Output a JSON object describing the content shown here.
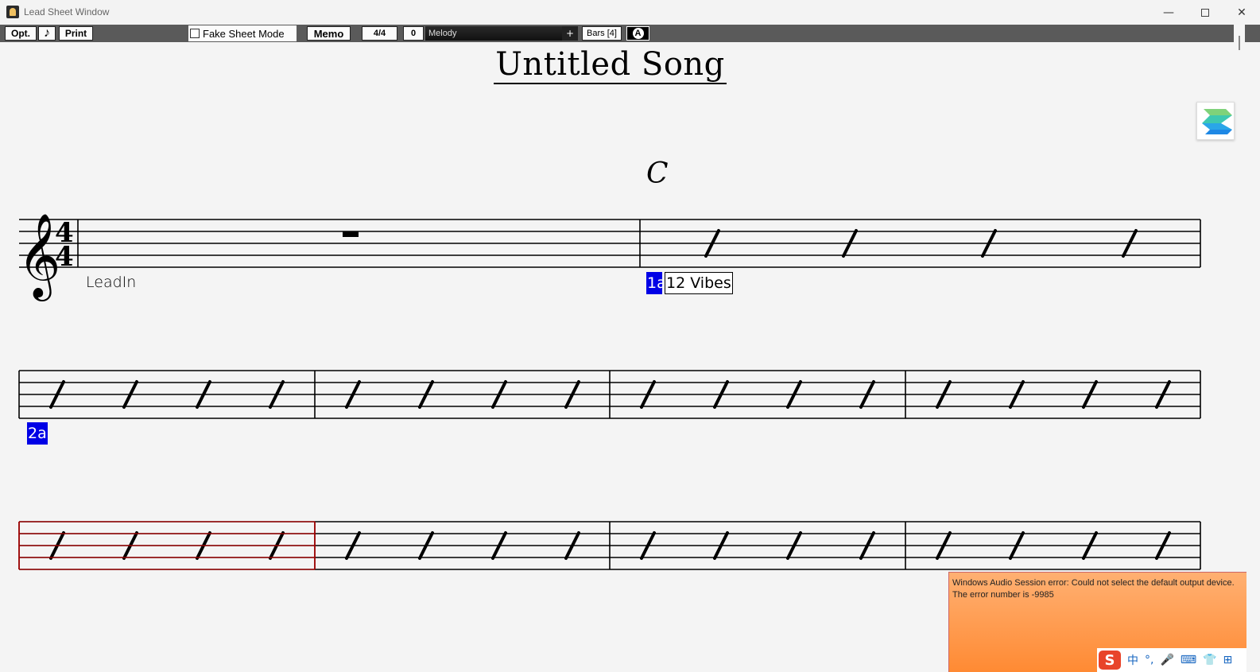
{
  "window": {
    "title": "Lead Sheet Window",
    "minimize_glyph": "—",
    "close_glyph": "✕"
  },
  "toolbar": {
    "opt_label": "Opt.",
    "note_glyph": "♪",
    "print_label": "Print",
    "fake_sheet_label": "Fake Sheet Mode",
    "memo_label": "Memo",
    "time_sig_label": "4/4",
    "transpose_label": "0",
    "track_label": "Melody",
    "plus_label": "+",
    "bars_label": "Bars [4]",
    "font_glyph": "A"
  },
  "song": {
    "title": "Untitled Song"
  },
  "score": {
    "chord_bar2": "C",
    "leadin_label": "LeadIn",
    "part_marker_1": "1a",
    "style_label": "12 Vibes",
    "part_marker_2": "2a",
    "time_signature_top": "4",
    "time_signature_bottom": "4",
    "treble_clef_glyph": "𝄞",
    "highlight_color": "#b00000",
    "part_marker_color": "#0000e6"
  },
  "error_popup": {
    "message": "Windows Audio Session error: Could not select the default output device. The error number is -9985"
  },
  "ime": {
    "logo": "S",
    "items": [
      "中",
      "°,",
      "🎤",
      "⌨",
      "👕",
      "⊞"
    ]
  }
}
